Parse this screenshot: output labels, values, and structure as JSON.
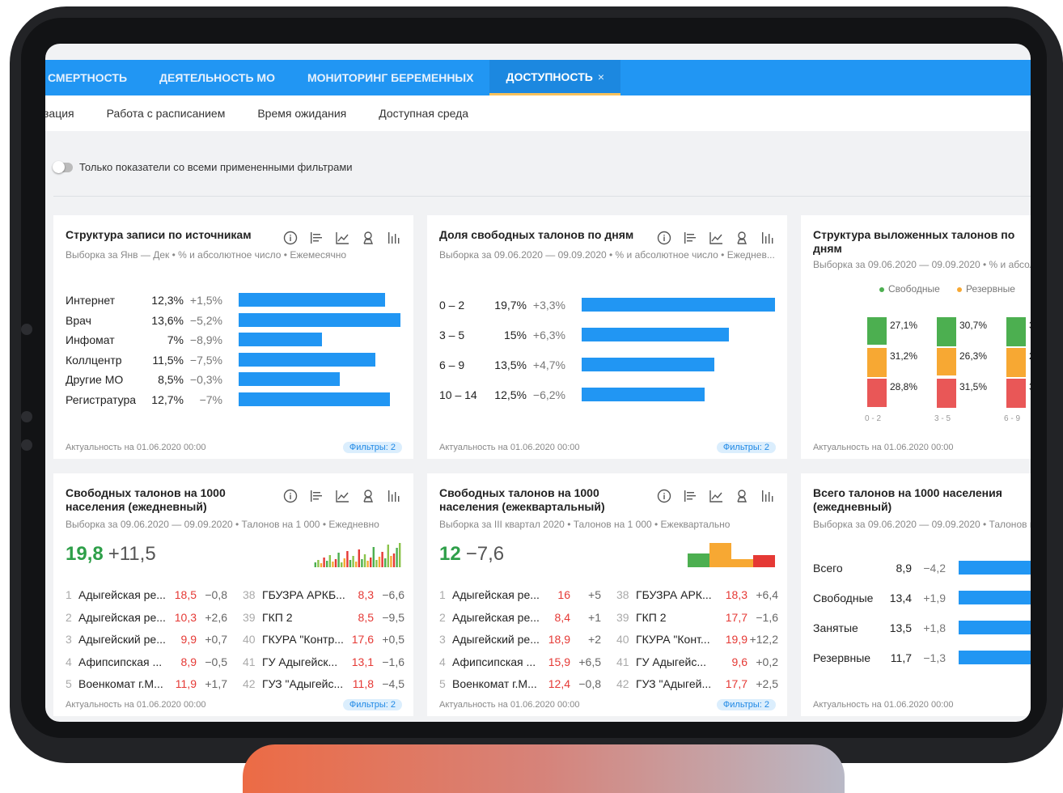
{
  "tabs": [
    {
      "label": "СМЕРТНОСТЬ",
      "active": false
    },
    {
      "label": "ДЕЯТЕЛЬНОСТЬ МО",
      "active": false
    },
    {
      "label": "МОНИТОРИНГ БЕРЕМЕННЫХ",
      "active": false
    },
    {
      "label": "ДОСТУПНОСТЬ",
      "active": true,
      "close": "×"
    }
  ],
  "subtabs": [
    "зация",
    "Работа с расписанием",
    "Время ожидания",
    "Доступная среда"
  ],
  "filter_toggle": {
    "label": "Только показатели со всеми примененными фильтрами",
    "on": false
  },
  "colors": {
    "accent": "#2196f3",
    "positive": "#2e9f49",
    "negative": "#e53935",
    "reserve": "#f7a833",
    "free": "#4caf50"
  },
  "common": {
    "actual": "Актуальность на 01.06.2020 00:00",
    "filters": "Фильтры: 2"
  },
  "card1": {
    "title": "Структура записи по источникам",
    "subtitle": "Выборка за Янв — Дек • % и абсолютное число • Ежемесячно",
    "rows": [
      {
        "name": "Интернет",
        "pct": "12,3%",
        "delta": "+1,5%",
        "value": 12.3
      },
      {
        "name": "Врач",
        "pct": "13,6%",
        "delta": "−5,2%",
        "value": 13.6
      },
      {
        "name": "Инфомат",
        "pct": "7%",
        "delta": "−8,9%",
        "value": 7
      },
      {
        "name": "Коллцентр",
        "pct": "11,5%",
        "delta": "−7,5%",
        "value": 11.5
      },
      {
        "name": "Другие МО",
        "pct": "8,5%",
        "delta": "−0,3%",
        "value": 8.5
      },
      {
        "name": "Регистратура",
        "pct": "12,7%",
        "delta": "−7%",
        "value": 12.7
      }
    ]
  },
  "card2": {
    "title": "Доля свободных талонов по дням",
    "subtitle": "Выборка за 09.06.2020 — 09.09.2020 • % и абсолютное число • Ежеднев...",
    "rows": [
      {
        "name": "0 – 2",
        "pct": "19,7%",
        "delta": "+3,3%",
        "value": 19.7
      },
      {
        "name": "3 – 5",
        "pct": "15%",
        "delta": "+6,3%",
        "value": 15
      },
      {
        "name": "6 – 9",
        "pct": "13,5%",
        "delta": "+4,7%",
        "value": 13.5
      },
      {
        "name": "10 – 14",
        "pct": "12,5%",
        "delta": "−6,2%",
        "value": 12.5
      }
    ]
  },
  "card3": {
    "title_line1": "Структура выложенных талонов по",
    "title_line2": "дням",
    "subtitle": "Выборка за 09.06.2020 — 09.09.2020 • % и абсол",
    "legend": [
      "Свободные",
      "Резервные"
    ],
    "chart_data": {
      "type": "bar",
      "categories": [
        "0 - 2",
        "3 - 5",
        "6 - 9"
      ],
      "series": [
        {
          "name": "Свободные",
          "values": [
            27.1,
            30.7,
            null
          ],
          "labels": [
            "27,1%",
            "30,7%",
            "3"
          ]
        },
        {
          "name": "Резервные",
          "values": [
            31.2,
            26.3,
            null
          ],
          "labels": [
            "31,2%",
            "26,3%",
            "2"
          ]
        },
        {
          "values": [
            28.8,
            31.5,
            null
          ],
          "labels": [
            "28,8%",
            "31,5%",
            "3"
          ]
        }
      ]
    }
  },
  "card4": {
    "title_line1": "Свободных талонов на 1000",
    "title_line2": "населения (ежедневный)",
    "subtitle": "Выборка за 09.06.2020 — 09.09.2020 • Талонов на 1 000 • Ежедневно",
    "big_value": "19,8",
    "big_delta": "+11,5",
    "spark": [
      6,
      9,
      5,
      12,
      8,
      15,
      7,
      10,
      18,
      6,
      11,
      20,
      9,
      14,
      7,
      22,
      10,
      16,
      8,
      12,
      25,
      9,
      13,
      19,
      11,
      28,
      14,
      17,
      24,
      30
    ],
    "left": [
      {
        "n": "1",
        "name": "Адыгейская ре...",
        "v": "18,5",
        "d": "−0,8"
      },
      {
        "n": "2",
        "name": "Адыгейская ре...",
        "v": "10,3",
        "d": "+2,6"
      },
      {
        "n": "3",
        "name": "Адыгейский ре...",
        "v": "9,9",
        "d": "+0,7"
      },
      {
        "n": "4",
        "name": "Афипсипская ...",
        "v": "8,9",
        "d": "−0,5"
      },
      {
        "n": "5",
        "name": "Военкомат г.М...",
        "v": "11,9",
        "d": "+1,7"
      }
    ],
    "right": [
      {
        "n": "38",
        "name": "ГБУЗРА АРКБ...",
        "v": "8,3",
        "d": "−6,6"
      },
      {
        "n": "39",
        "name": "ГКП 2",
        "v": "8,5",
        "d": "−9,5"
      },
      {
        "n": "40",
        "name": "ГКУРА \"Контр...",
        "v": "17,6",
        "d": "+0,5"
      },
      {
        "n": "41",
        "name": "ГУ Адыгейск...",
        "v": "13,1",
        "d": "−1,6"
      },
      {
        "n": "42",
        "name": "ГУЗ \"Адыгейс...",
        "v": "11,8",
        "d": "−4,5"
      }
    ]
  },
  "card5": {
    "title_line1": "Свободных талонов на 1000",
    "title_line2": "населения (ежеквартальный)",
    "subtitle": "Выборка за III квартал 2020 • Талонов на 1 000 • Ежеквартально",
    "big_value": "12",
    "big_delta": "−7,6",
    "left": [
      {
        "n": "1",
        "name": "Адыгейская ре...",
        "v": "16",
        "d": "+5"
      },
      {
        "n": "2",
        "name": "Адыгейская ре...",
        "v": "8,4",
        "d": "+1"
      },
      {
        "n": "3",
        "name": "Адыгейский ре...",
        "v": "18,9",
        "d": "+2"
      },
      {
        "n": "4",
        "name": "Афипсипская ...",
        "v": "15,9",
        "d": "+6,5"
      },
      {
        "n": "5",
        "name": "Военкомат г.М...",
        "v": "12,4",
        "d": "−0,8"
      }
    ],
    "right": [
      {
        "n": "38",
        "name": "ГБУЗРА АРК...",
        "v": "18,3",
        "d": "+6,4"
      },
      {
        "n": "39",
        "name": "ГКП 2",
        "v": "17,7",
        "d": "−1,6"
      },
      {
        "n": "40",
        "name": "ГКУРА \"Конт...",
        "v": "19,9",
        "d": "+12,2"
      },
      {
        "n": "41",
        "name": "ГУ Адыгейс...",
        "v": "9,6",
        "d": "+0,2"
      },
      {
        "n": "42",
        "name": "ГУЗ \"Адыгей...",
        "v": "17,7",
        "d": "+2,5"
      }
    ]
  },
  "card6": {
    "title_line1": "Всего талонов на 1000 населения",
    "title_line2": "(ежедневный)",
    "subtitle": "Выборка за 09.06.2020 — 09.09.2020 • Талонов н",
    "rows": [
      {
        "name": "Всего",
        "v": "8,9",
        "d": "−4,2"
      },
      {
        "name": "Свободные",
        "v": "13,4",
        "d": "+1,9"
      },
      {
        "name": "Занятые",
        "v": "13,5",
        "d": "+1,8"
      },
      {
        "name": "Резервные",
        "v": "11,7",
        "d": "−1,3"
      }
    ]
  }
}
